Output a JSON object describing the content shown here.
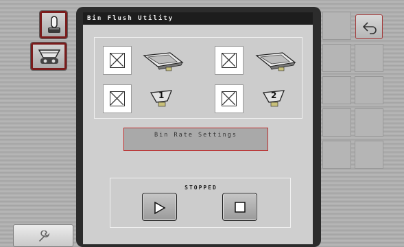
{
  "window": {
    "title": "Bin Flush Utility"
  },
  "left_nav": {
    "items": [
      {
        "icon": "joystick-icon",
        "selected": true
      },
      {
        "icon": "bin-flush-icon",
        "selected": true
      }
    ],
    "bottom_icon": "wrench-icon"
  },
  "bins": [
    {
      "icon": "main-bin-icon",
      "checked": false
    },
    {
      "icon": "main-bin-icon",
      "checked": false
    },
    {
      "icon": "bin-1-icon",
      "number": "1",
      "checked": false
    },
    {
      "icon": "bin-2-icon",
      "number": "2",
      "checked": false
    }
  ],
  "settings": {
    "bin_rate_label": "Bin Rate Settings"
  },
  "status": {
    "text": "STOPPED"
  },
  "controls": {
    "play_icon": "play-icon",
    "stop_icon": "stop-icon"
  },
  "right_grid": {
    "back_icon": "back-arrow-icon"
  },
  "colors": {
    "accent": "#bd2b2b",
    "selected_border": "#7a1c1c",
    "title_bar": "#1d1d1d"
  }
}
